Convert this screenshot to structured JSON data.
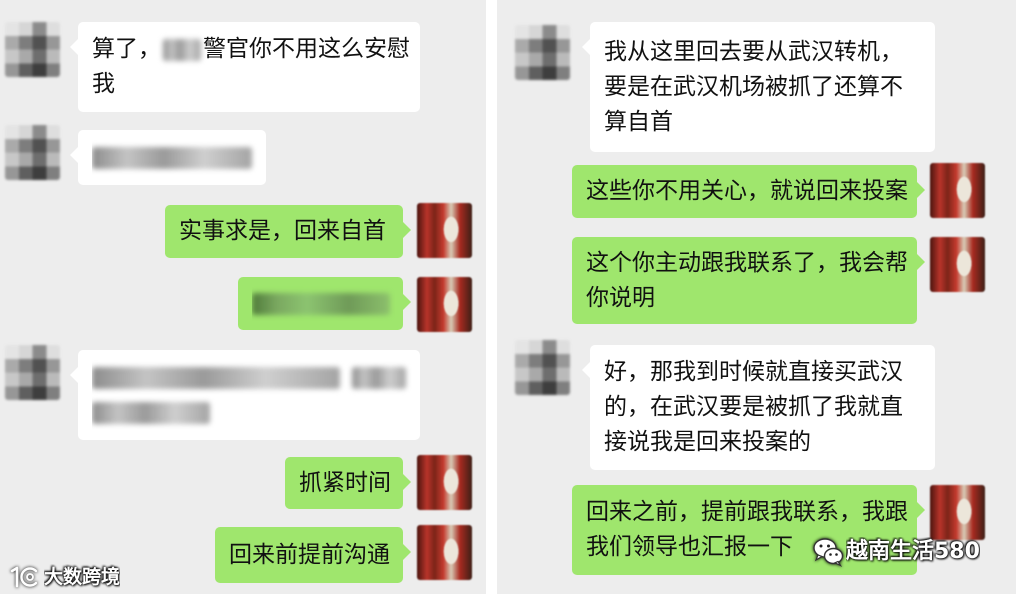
{
  "left_chat": {
    "received_1": {
      "line1_start": "算了，",
      "line1_end": "警官你不用这么安慰",
      "line2": "我"
    },
    "sent_1": "实事求是，回来自首",
    "sent_3": "抓紧时间",
    "sent_4": "回来前提前沟通"
  },
  "right_chat": {
    "received_1": [
      "我从这里回去要从武汉转机，",
      "要是在武汉机场被抓了还算不",
      "算自首"
    ],
    "sent_1": [
      "这些你不用关心，就说回来投案"
    ],
    "sent_2": [
      "这个你主动跟我联系了，我会帮",
      "你说明"
    ],
    "received_2": [
      "好，那我到时候就直接买武汉",
      "的，在武汉要是被抓了我就直",
      "接说我是回来投案的"
    ],
    "sent_3": [
      "回来之前，提前跟我联系，我跟",
      "我们领导也汇报一下"
    ]
  },
  "watermarks": {
    "bottom_left": "大数跨境",
    "bottom_right": "越南生活580"
  },
  "icons": {
    "bottom_left_watermark": "brand-logo-icon",
    "bottom_right_watermark": "wechat-icon"
  },
  "colors": {
    "panel_background": "#ededed",
    "received_bubble": "#ffffff",
    "sent_bubble": "#9fe66d",
    "text": "#111111",
    "divider": "#ffffff",
    "watermark_text": "#ffffff"
  }
}
